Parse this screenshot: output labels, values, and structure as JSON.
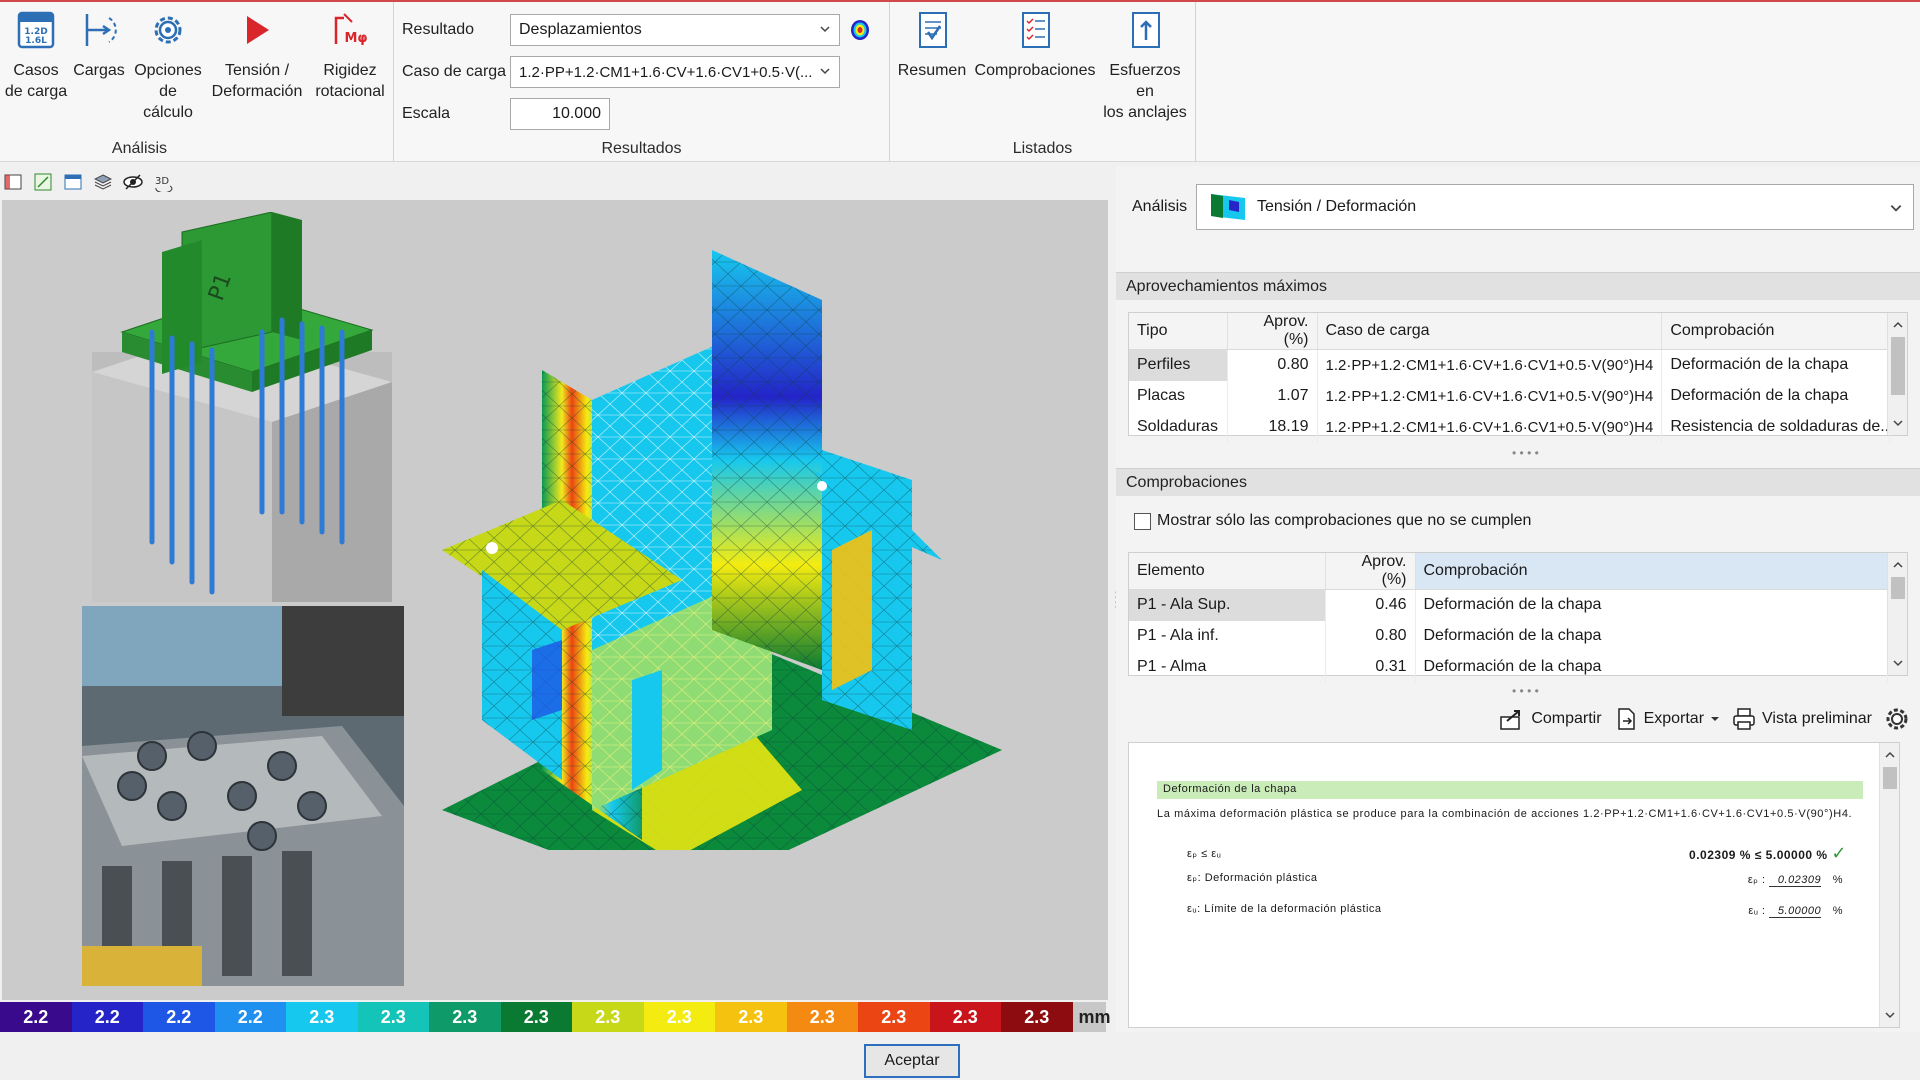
{
  "ribbon": {
    "analysis": {
      "label": "Análisis",
      "buttons": [
        {
          "label": "Casos\nde carga",
          "icon": "load-cases-icon"
        },
        {
          "label": "Cargas",
          "icon": "loads-icon"
        },
        {
          "label": "Opciones\nde cálculo",
          "icon": "gear-icon"
        },
        {
          "label": "Tensión /\nDeformación",
          "icon": "play-icon"
        },
        {
          "label": "Rigidez\nrotacional",
          "icon": "rotational-stiffness-icon"
        }
      ]
    },
    "results": {
      "label": "Resultados",
      "resultado_label": "Resultado",
      "resultado_value": "Desplazamientos",
      "caso_label": "Caso de carga",
      "caso_value": "1.2·PP+1.2·CM1+1.6·CV+1.6·CV1+0.5·V(...",
      "escala_label": "Escala",
      "escala_value": "10.000"
    },
    "listados": {
      "label": "Listados",
      "buttons": [
        {
          "label": "Resumen",
          "icon": "summary-report-icon"
        },
        {
          "label": "Comprobaciones",
          "icon": "checklist-report-icon"
        },
        {
          "label": "Esfuerzos en\nlos anclajes",
          "icon": "anchor-forces-report-icon"
        }
      ]
    }
  },
  "legend": {
    "values": [
      "2.2",
      "2.2",
      "2.2",
      "2.2",
      "2.3",
      "2.3",
      "2.3",
      "2.3",
      "2.3",
      "2.3",
      "2.3",
      "2.3",
      "2.3",
      "2.3",
      "2.3"
    ],
    "colors": [
      "#3a0a8c",
      "#2424c8",
      "#1e56e6",
      "#1f8ff0",
      "#17c8ee",
      "#14c4b8",
      "#0f9a6a",
      "#0a7a32",
      "#c6d818",
      "#f4ec10",
      "#f5c20f",
      "#f48a12",
      "#ea4512",
      "#c8141a",
      "#8c0c10"
    ],
    "unit": "mm"
  },
  "panel": {
    "analysis_label": "Análisis",
    "analysis_value": "Tensión / Deformación",
    "max_title": "Aprovechamientos máximos",
    "max_headers": [
      "Tipo",
      "Aprov. (%)",
      "Caso de carga",
      "Comprobación"
    ],
    "max_rows": [
      [
        "Perfiles",
        "0.80",
        "1.2·PP+1.2·CM1+1.6·CV+1.6·CV1+0.5·V(90°)H4",
        "Deformación de la chapa"
      ],
      [
        "Placas",
        "1.07",
        "1.2·PP+1.2·CM1+1.6·CV+1.6·CV1+0.5·V(90°)H4",
        "Deformación de la chapa"
      ],
      [
        "Soldaduras",
        "18.19",
        "1.2·PP+1.2·CM1+1.6·CV+1.6·CV1+0.5·V(90°)H4",
        "Resistencia de soldaduras de..."
      ]
    ],
    "checks_title": "Comprobaciones",
    "only_failing_label": "Mostrar sólo las comprobaciones que no se cumplen",
    "checks_headers": [
      "Elemento",
      "Aprov. (%)",
      "Comprobación"
    ],
    "checks_rows": [
      [
        "P1 - Ala Sup.",
        "0.46",
        "Deformación de la chapa"
      ],
      [
        "P1 - Ala inf.",
        "0.80",
        "Deformación de la chapa"
      ],
      [
        "P1 - Alma",
        "0.31",
        "Deformación de la chapa"
      ]
    ],
    "share_label": "Compartir",
    "export_label": "Exportar",
    "preview_label": "Vista preliminar"
  },
  "report": {
    "title": "Deformación de la chapa",
    "text": "La máxima deformación plástica se produce para la combinación de acciones 1.2·PP+1.2·CM1+1.6·CV+1.6·CV1+0.5·V(90°)H4.",
    "condition": "εₚ ≤ εᵤ",
    "result": "0.02309 % ≤ 5.00000 %",
    "eps_p_label": "εₚ: Deformación plástica",
    "eps_p_sym": "εₚ :",
    "eps_p_value": "0.02309",
    "eps_u_label": "εᵤ: Límite de la deformación plástica",
    "eps_u_sym": "εᵤ :",
    "eps_u_value": "5.00000",
    "unit": "%"
  },
  "viewer": {
    "model_tag": "P1"
  },
  "accept_label": "Aceptar"
}
